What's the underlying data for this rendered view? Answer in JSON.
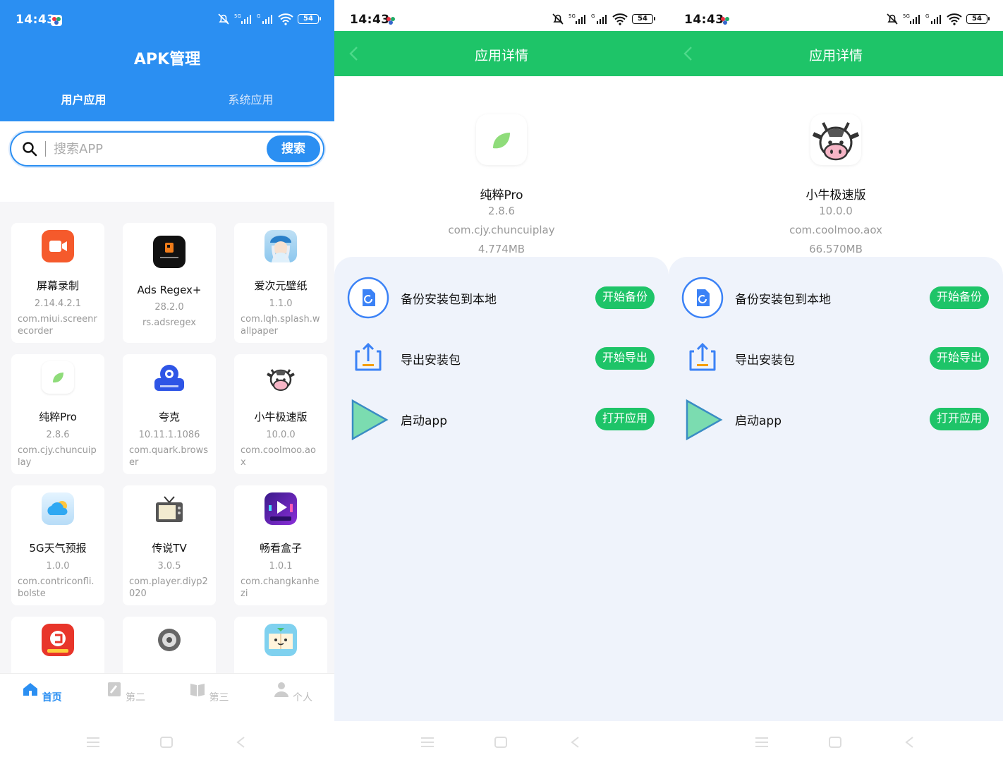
{
  "status": {
    "time": "14:43",
    "battery": "54",
    "signal1": "5G",
    "signal2": "G"
  },
  "colors": {
    "blue": "#2b8ff2",
    "green": "#1ec468"
  },
  "apk": {
    "title": "APK管理",
    "tabs": [
      "用户应用",
      "系统应用"
    ],
    "search": {
      "placeholder": "搜索APP",
      "button": "搜索"
    },
    "apps": [
      {
        "name": "屏幕录制",
        "version": "2.14.4.2.1",
        "package": "com.miui.screenrecorder",
        "icon": "screen-record-icon"
      },
      {
        "name": "Ads Regex+",
        "version": "28.2.0",
        "package": "rs.adsregex",
        "icon": "ads-regex-icon"
      },
      {
        "name": "爱次元壁纸",
        "version": "1.1.0",
        "package": "com.lqh.splash.wallpaper",
        "icon": "wallpaper-girl-icon"
      },
      {
        "name": "纯粹Pro",
        "version": "2.8.6",
        "package": "com.cjy.chuncuiplay",
        "icon": "leaf-icon"
      },
      {
        "name": "夸克",
        "version": "10.11.1.1086",
        "package": "com.quark.browser",
        "icon": "quark-icon"
      },
      {
        "name": "小牛极速版",
        "version": "10.0.0",
        "package": "com.coolmoo.aox",
        "icon": "cow-icon"
      },
      {
        "name": "5G天气预报",
        "version": "1.0.0",
        "package": "com.contriconfli.bolste",
        "icon": "weather-cloud-icon"
      },
      {
        "name": "传说TV",
        "version": "3.0.5",
        "package": "com.player.diyp2020",
        "icon": "tv-icon"
      },
      {
        "name": "畅看盒子",
        "version": "1.0.1",
        "package": "com.changkanhezi",
        "icon": "play-box-icon"
      }
    ],
    "nav": [
      "首页",
      "第二",
      "第三",
      "个人"
    ]
  },
  "details": {
    "header": "应用详情",
    "actions": [
      {
        "label": "备份安装包到本地",
        "button": "开始备份"
      },
      {
        "label": "导出安装包",
        "button": "开始导出"
      },
      {
        "label": "启动app",
        "button": "打开应用"
      }
    ],
    "app1": {
      "name": "纯粹Pro",
      "version": "2.8.6",
      "package": "com.cjy.chuncuiplay",
      "size": "4.774MB"
    },
    "app2": {
      "name": "小牛极速版",
      "version": "10.0.0",
      "package": "com.coolmoo.aox",
      "size": "66.570MB"
    }
  }
}
